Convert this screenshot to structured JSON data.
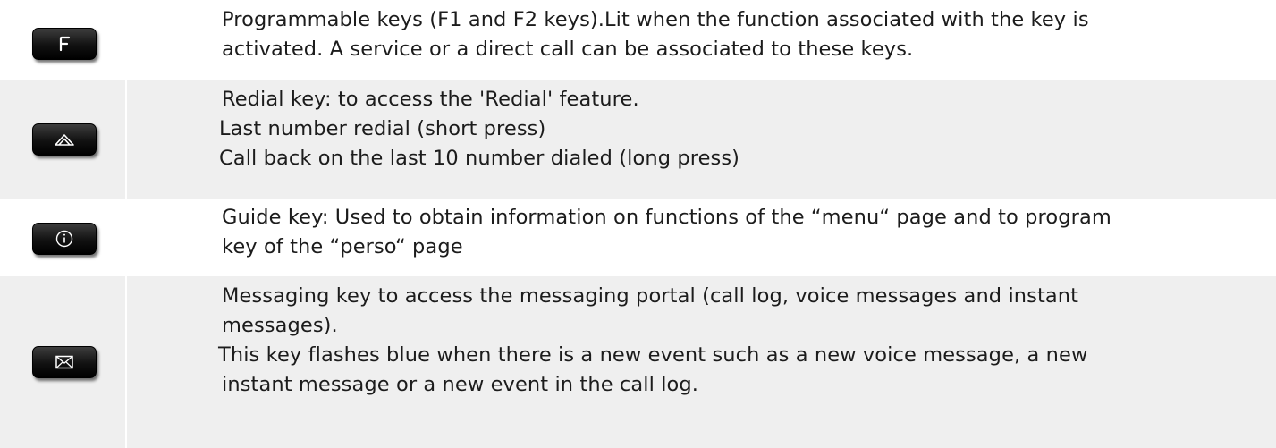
{
  "rows": [
    {
      "icon": "f-key-icon",
      "lines": [
        "Programmable keys (F1 and F2 keys).Lit when the function associated with the key is",
        "activated. A service or a direct call can be associated to these keys."
      ]
    },
    {
      "icon": "redial-key-icon",
      "lines": [
        "Redial key: to access the 'Redial' feature.",
        "Last number redial (short press)",
        "Call back on the last 10 number dialed (long press)"
      ]
    },
    {
      "icon": "info-key-icon",
      "lines": [
        "Guide key: Used to obtain information on functions of the “menu“ page and to program",
        "key of the “perso“ page"
      ]
    },
    {
      "icon": "envelope-key-icon",
      "lines": [
        "Messaging key to access the messaging portal (call log, voice messages and instant",
        "messages).",
        "This key flashes blue when there is a new event such as a new voice message, a new",
        "instant message or a new event in the call log."
      ]
    }
  ]
}
